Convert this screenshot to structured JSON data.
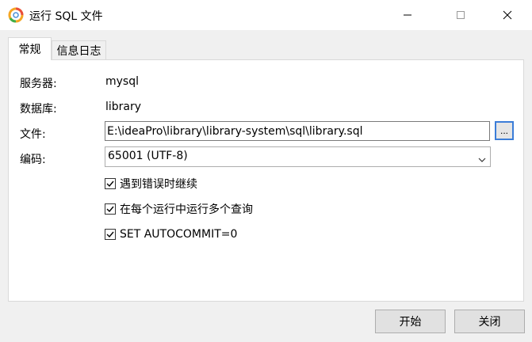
{
  "window": {
    "title": "运行 SQL 文件",
    "app_icon": "navicat-logo-icon"
  },
  "tabs": [
    {
      "label": "常规",
      "active": true
    },
    {
      "label": "信息日志",
      "active": false
    }
  ],
  "form": {
    "server_label": "服务器:",
    "server_value": "mysql",
    "database_label": "数据库:",
    "database_value": "library",
    "file_label": "文件:",
    "file_value": "E:\\ideaPro\\library\\library-system\\sql\\library.sql",
    "browse_label": "...",
    "encoding_label": "编码:",
    "encoding_value": "65001 (UTF-8)"
  },
  "options": [
    {
      "label": "遇到错误时继续",
      "checked": true
    },
    {
      "label": "在每个运行中运行多个查询",
      "checked": true
    },
    {
      "label": "SET AUTOCOMMIT=0",
      "checked": true
    }
  ],
  "buttons": {
    "start": "开始",
    "close": "关闭"
  },
  "colors": {
    "accent": "#3b7dd8",
    "panel_bg": "#ffffff",
    "window_bg": "#f0f0f0"
  }
}
